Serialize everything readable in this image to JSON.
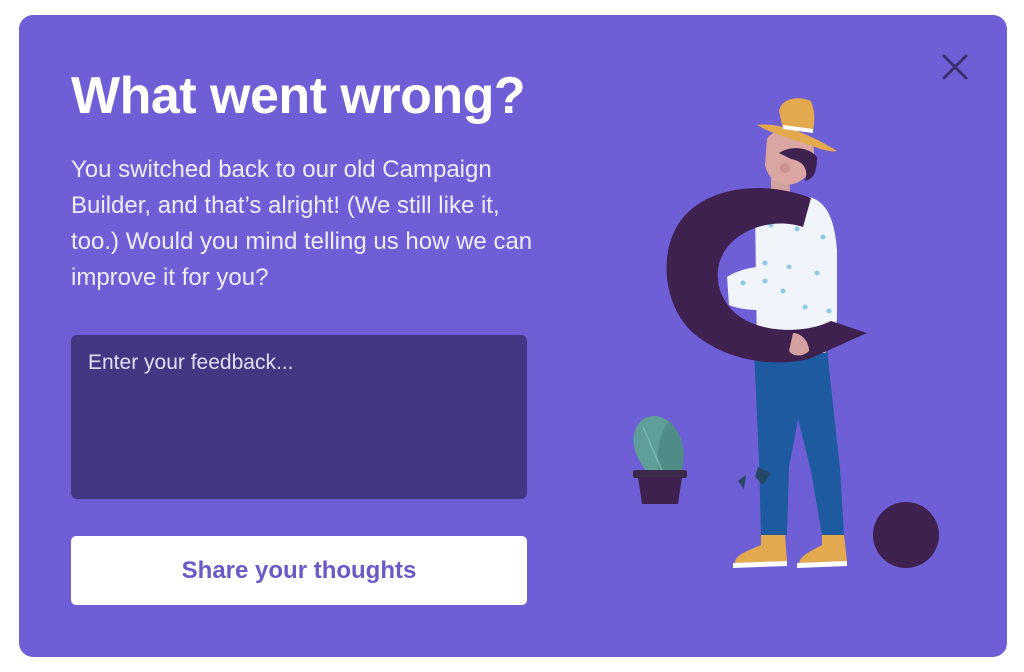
{
  "dialog": {
    "title": "What went wrong?",
    "message": "You switched back to our old Campaign Builder, and that’s alright! (We still like it, too.) Would you mind telling us how we can improve it for you?",
    "feedback": {
      "value": "",
      "placeholder": "Enter your feedback..."
    },
    "submit_label": "Share your thoughts",
    "close_icon": "close-icon",
    "illustration": "person-holding-letter-c-illustration"
  },
  "colors": {
    "background": "#6e5fd6",
    "input_background": "#433683",
    "button_background": "#ffffff",
    "button_text": "#6a5ac8",
    "illustration_dark": "#3f2150"
  }
}
